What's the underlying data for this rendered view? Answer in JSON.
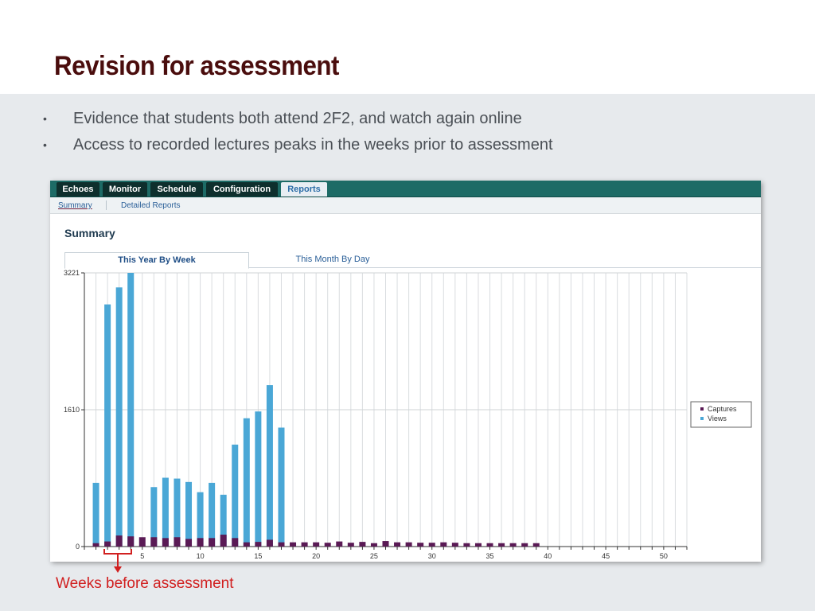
{
  "slide": {
    "title": "Revision for assessment",
    "bullets": [
      "Evidence that students both attend 2F2, and watch again online",
      "Access to recorded lectures peaks in the weeks prior to assessment"
    ],
    "bullet_glyph": "•",
    "annotation": "Weeks before assessment"
  },
  "app": {
    "nav_tabs": [
      "Echoes",
      "Monitor",
      "Schedule",
      "Configuration",
      "Reports"
    ],
    "active_tab": "Reports",
    "subnav": [
      "Summary",
      "Detailed Reports"
    ],
    "active_subnav": "Summary",
    "heading": "Summary",
    "chart_tabs": [
      "This Year By Week",
      "This Month By Day"
    ],
    "active_chart_tab": "This Year By Week"
  },
  "colors": {
    "title": "#4a0d0d",
    "panel": "#e7eaed",
    "nav_bar": "#1d6b66",
    "views": "#4aa7d6",
    "captures": "#5a1a55",
    "annotation": "#d12020"
  },
  "chart_data": {
    "type": "bar",
    "x": [
      1,
      2,
      3,
      4,
      5,
      6,
      7,
      8,
      9,
      10,
      11,
      12,
      13,
      14,
      15,
      16,
      17,
      18,
      19,
      20,
      21,
      22,
      23,
      24,
      25,
      26,
      27,
      28,
      29,
      30,
      31,
      32,
      33,
      34,
      35,
      36,
      37,
      38,
      39,
      40,
      41,
      42,
      43,
      44,
      45,
      46,
      47,
      48,
      49,
      50,
      51,
      52
    ],
    "xticks": [
      5,
      10,
      15,
      20,
      25,
      30,
      35,
      40,
      45,
      50
    ],
    "yticks": [
      0,
      1610,
      3221
    ],
    "ylim": [
      0,
      3221
    ],
    "grid": true,
    "legend_position": "right",
    "series": [
      {
        "name": "Captures",
        "color": "#5a1a55",
        "values": [
          40,
          60,
          130,
          120,
          110,
          110,
          100,
          110,
          90,
          100,
          100,
          140,
          100,
          50,
          55,
          80,
          50,
          50,
          50,
          50,
          45,
          60,
          45,
          55,
          40,
          65,
          50,
          50,
          45,
          45,
          50,
          45,
          40,
          40,
          40,
          40,
          40,
          40,
          40,
          0,
          0,
          0,
          0,
          0,
          0,
          0,
          0,
          0,
          0,
          0,
          0,
          0
        ]
      },
      {
        "name": "Views",
        "color": "#4aa7d6",
        "values": [
          750,
          2850,
          3050,
          3221,
          0,
          700,
          810,
          800,
          760,
          640,
          750,
          610,
          1200,
          1510,
          1590,
          1900,
          1400,
          0,
          0,
          0,
          0,
          0,
          0,
          0,
          0,
          0,
          0,
          0,
          0,
          0,
          0,
          0,
          0,
          0,
          0,
          0,
          0,
          0,
          0,
          0,
          0,
          0,
          0,
          0,
          0,
          0,
          0,
          0,
          0,
          0,
          0,
          0
        ]
      }
    ]
  }
}
